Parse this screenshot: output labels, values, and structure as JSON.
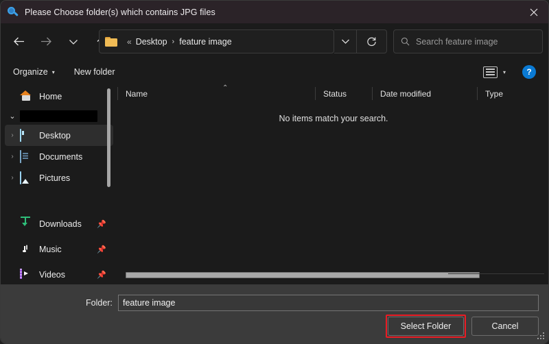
{
  "window": {
    "title": "Please Choose folder(s) which contains JPG files",
    "title_icon": "search-icon",
    "close_label": "✕"
  },
  "nav": {
    "back": "←",
    "forward": "→",
    "recent": "⌄",
    "up": "↑"
  },
  "breadcrumb": {
    "overflow": "«",
    "separator": "›",
    "items": [
      "Desktop",
      "feature image"
    ],
    "dropdown_caret": "⌄",
    "refresh": "⟳"
  },
  "search": {
    "placeholder": "Search feature image",
    "icon": "search-icon"
  },
  "commandbar": {
    "organize_label": "Organize",
    "organize_caret": "▾",
    "new_folder_label": "New folder",
    "view_caret": "▾",
    "help_label": "?"
  },
  "sidebar": {
    "items": [
      {
        "label": "Home",
        "icon": "home-icon",
        "chevron": "",
        "selected": false,
        "pinned": false
      },
      {
        "label": "",
        "icon": "redacted",
        "chevron": "⌄",
        "selected": false,
        "pinned": false
      },
      {
        "label": "Desktop",
        "icon": "desktop-icon",
        "chevron": "›",
        "selected": true,
        "pinned": false
      },
      {
        "label": "Documents",
        "icon": "documents-icon",
        "chevron": "›",
        "selected": false,
        "pinned": false
      },
      {
        "label": "Pictures",
        "icon": "pictures-icon",
        "chevron": "›",
        "selected": false,
        "pinned": false
      },
      {
        "label": "Downloads",
        "icon": "downloads-icon",
        "chevron": "",
        "selected": false,
        "pinned": true
      },
      {
        "label": "Music",
        "icon": "music-icon",
        "chevron": "",
        "selected": false,
        "pinned": true
      },
      {
        "label": "Videos",
        "icon": "videos-icon",
        "chevron": "",
        "selected": false,
        "pinned": true
      }
    ],
    "pin_glyph": "📌"
  },
  "filelist": {
    "columns": [
      {
        "label": "Name",
        "sorted": true,
        "sort_caret": "⌃"
      },
      {
        "label": "Status",
        "sorted": false,
        "sort_caret": ""
      },
      {
        "label": "Date modified",
        "sorted": false,
        "sort_caret": ""
      },
      {
        "label": "Type",
        "sorted": false,
        "sort_caret": ""
      }
    ],
    "empty_message": "No items match your search.",
    "rows": []
  },
  "footer": {
    "folder_label": "Folder:",
    "folder_value": "feature image",
    "select_button": "Select Folder",
    "cancel_button": "Cancel"
  },
  "colors": {
    "titlebar": "#2b2328",
    "body": "#1b1b1b",
    "footer": "#3b3b3b",
    "accent_help": "#0a7ad4",
    "highlight_ring": "#ec1c24",
    "selection": "#2e2e2e"
  }
}
